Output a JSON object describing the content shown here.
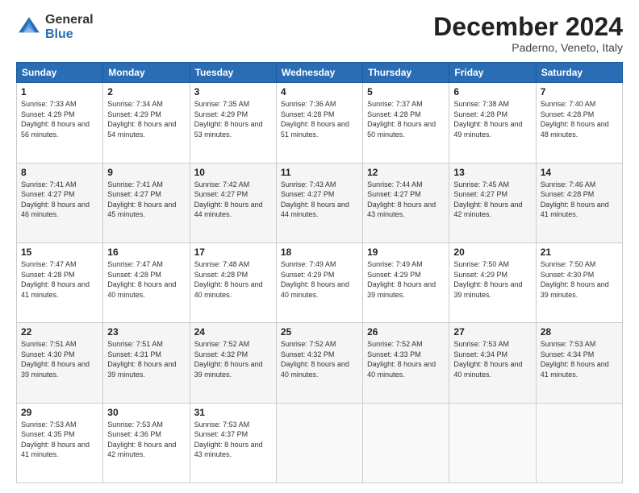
{
  "logo": {
    "general": "General",
    "blue": "Blue"
  },
  "title": "December 2024",
  "location": "Paderno, Veneto, Italy",
  "days_of_week": [
    "Sunday",
    "Monday",
    "Tuesday",
    "Wednesday",
    "Thursday",
    "Friday",
    "Saturday"
  ],
  "weeks": [
    [
      {
        "day": "1",
        "sunrise": "7:33 AM",
        "sunset": "4:29 PM",
        "daylight": "8 hours and 56 minutes."
      },
      {
        "day": "2",
        "sunrise": "7:34 AM",
        "sunset": "4:29 PM",
        "daylight": "8 hours and 54 minutes."
      },
      {
        "day": "3",
        "sunrise": "7:35 AM",
        "sunset": "4:29 PM",
        "daylight": "8 hours and 53 minutes."
      },
      {
        "day": "4",
        "sunrise": "7:36 AM",
        "sunset": "4:28 PM",
        "daylight": "8 hours and 51 minutes."
      },
      {
        "day": "5",
        "sunrise": "7:37 AM",
        "sunset": "4:28 PM",
        "daylight": "8 hours and 50 minutes."
      },
      {
        "day": "6",
        "sunrise": "7:38 AM",
        "sunset": "4:28 PM",
        "daylight": "8 hours and 49 minutes."
      },
      {
        "day": "7",
        "sunrise": "7:40 AM",
        "sunset": "4:28 PM",
        "daylight": "8 hours and 48 minutes."
      }
    ],
    [
      {
        "day": "8",
        "sunrise": "7:41 AM",
        "sunset": "4:27 PM",
        "daylight": "8 hours and 46 minutes."
      },
      {
        "day": "9",
        "sunrise": "7:41 AM",
        "sunset": "4:27 PM",
        "daylight": "8 hours and 45 minutes."
      },
      {
        "day": "10",
        "sunrise": "7:42 AM",
        "sunset": "4:27 PM",
        "daylight": "8 hours and 44 minutes."
      },
      {
        "day": "11",
        "sunrise": "7:43 AM",
        "sunset": "4:27 PM",
        "daylight": "8 hours and 44 minutes."
      },
      {
        "day": "12",
        "sunrise": "7:44 AM",
        "sunset": "4:27 PM",
        "daylight": "8 hours and 43 minutes."
      },
      {
        "day": "13",
        "sunrise": "7:45 AM",
        "sunset": "4:27 PM",
        "daylight": "8 hours and 42 minutes."
      },
      {
        "day": "14",
        "sunrise": "7:46 AM",
        "sunset": "4:28 PM",
        "daylight": "8 hours and 41 minutes."
      }
    ],
    [
      {
        "day": "15",
        "sunrise": "7:47 AM",
        "sunset": "4:28 PM",
        "daylight": "8 hours and 41 minutes."
      },
      {
        "day": "16",
        "sunrise": "7:47 AM",
        "sunset": "4:28 PM",
        "daylight": "8 hours and 40 minutes."
      },
      {
        "day": "17",
        "sunrise": "7:48 AM",
        "sunset": "4:28 PM",
        "daylight": "8 hours and 40 minutes."
      },
      {
        "day": "18",
        "sunrise": "7:49 AM",
        "sunset": "4:29 PM",
        "daylight": "8 hours and 40 minutes."
      },
      {
        "day": "19",
        "sunrise": "7:49 AM",
        "sunset": "4:29 PM",
        "daylight": "8 hours and 39 minutes."
      },
      {
        "day": "20",
        "sunrise": "7:50 AM",
        "sunset": "4:29 PM",
        "daylight": "8 hours and 39 minutes."
      },
      {
        "day": "21",
        "sunrise": "7:50 AM",
        "sunset": "4:30 PM",
        "daylight": "8 hours and 39 minutes."
      }
    ],
    [
      {
        "day": "22",
        "sunrise": "7:51 AM",
        "sunset": "4:30 PM",
        "daylight": "8 hours and 39 minutes."
      },
      {
        "day": "23",
        "sunrise": "7:51 AM",
        "sunset": "4:31 PM",
        "daylight": "8 hours and 39 minutes."
      },
      {
        "day": "24",
        "sunrise": "7:52 AM",
        "sunset": "4:32 PM",
        "daylight": "8 hours and 39 minutes."
      },
      {
        "day": "25",
        "sunrise": "7:52 AM",
        "sunset": "4:32 PM",
        "daylight": "8 hours and 40 minutes."
      },
      {
        "day": "26",
        "sunrise": "7:52 AM",
        "sunset": "4:33 PM",
        "daylight": "8 hours and 40 minutes."
      },
      {
        "day": "27",
        "sunrise": "7:53 AM",
        "sunset": "4:34 PM",
        "daylight": "8 hours and 40 minutes."
      },
      {
        "day": "28",
        "sunrise": "7:53 AM",
        "sunset": "4:34 PM",
        "daylight": "8 hours and 41 minutes."
      }
    ],
    [
      {
        "day": "29",
        "sunrise": "7:53 AM",
        "sunset": "4:35 PM",
        "daylight": "8 hours and 41 minutes."
      },
      {
        "day": "30",
        "sunrise": "7:53 AM",
        "sunset": "4:36 PM",
        "daylight": "8 hours and 42 minutes."
      },
      {
        "day": "31",
        "sunrise": "7:53 AM",
        "sunset": "4:37 PM",
        "daylight": "8 hours and 43 minutes."
      },
      null,
      null,
      null,
      null
    ]
  ],
  "labels": {
    "sunrise": "Sunrise:",
    "sunset": "Sunset:",
    "daylight": "Daylight:"
  }
}
